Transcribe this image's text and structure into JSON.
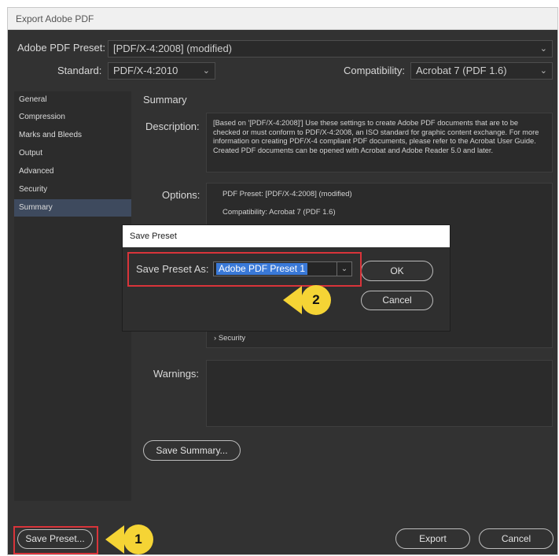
{
  "window": {
    "title": "Export Adobe PDF"
  },
  "preset": {
    "label": "Adobe PDF Preset:",
    "value": "[PDF/X-4:2008] (modified)"
  },
  "standard": {
    "label": "Standard:",
    "value": "PDF/X-4:2010"
  },
  "compatibility": {
    "label": "Compatibility:",
    "value": "Acrobat 7 (PDF 1.6)"
  },
  "sidebar": {
    "items": [
      {
        "label": "General"
      },
      {
        "label": "Compression"
      },
      {
        "label": "Marks and Bleeds"
      },
      {
        "label": "Output"
      },
      {
        "label": "Advanced"
      },
      {
        "label": "Security"
      },
      {
        "label": "Summary",
        "selected": true
      }
    ]
  },
  "summary": {
    "title": "Summary",
    "description_label": "Description:",
    "description": "[Based on '[PDF/X-4:2008]'] Use these settings to create Adobe PDF documents that are to be checked or must conform to PDF/X-4:2008, an ISO standard for graphic content exchange.  For more information on creating PDF/X-4 compliant PDF documents, please refer to the Acrobat User Guide.  Created PDF documents can be opened with Acrobat and Adobe Reader 5.0 and later.",
    "options_label": "Options:",
    "options": [
      "PDF Preset: [PDF/X-4:2008] (modified)",
      "Compatibility: Acrobat 7 (PDF 1.6)"
    ],
    "security_item": "Security",
    "warnings_label": "Warnings:",
    "save_summary": "Save Summary..."
  },
  "footer": {
    "save_preset": "Save Preset...",
    "export": "Export",
    "cancel": "Cancel"
  },
  "save_preset_dialog": {
    "title": "Save Preset",
    "field_label": "Save Preset As:",
    "field_value": "Adobe PDF Preset 1",
    "ok": "OK",
    "cancel": "Cancel"
  },
  "callouts": {
    "one": "1",
    "two": "2"
  },
  "colors": {
    "highlight_red": "#d9343a",
    "callout_yellow": "#f5d435",
    "selection_blue": "#3a79d8"
  }
}
